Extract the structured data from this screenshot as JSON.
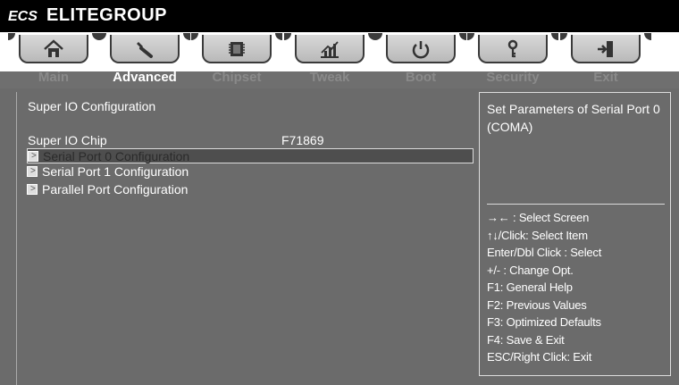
{
  "brand": {
    "name": "ELITEGROUP",
    "logo": "ECS"
  },
  "tabs": [
    {
      "label": "Main",
      "icon": "home-icon",
      "active": false
    },
    {
      "label": "Advanced",
      "icon": "wrench-icon",
      "active": true
    },
    {
      "label": "Chipset",
      "icon": "chip-icon",
      "active": false
    },
    {
      "label": "Tweak",
      "icon": "chart-icon",
      "active": false
    },
    {
      "label": "Boot",
      "icon": "power-icon",
      "active": false
    },
    {
      "label": "Security",
      "icon": "key-icon",
      "active": false
    },
    {
      "label": "Exit",
      "icon": "exit-icon",
      "active": false
    }
  ],
  "left": {
    "title": "Super IO Configuration",
    "chip_label": "Super IO Chip",
    "chip_value": "F71869",
    "menu": [
      {
        "label": "Serial Port 0 Configuration",
        "selected": true
      },
      {
        "label": "Serial Port 1 Configuration",
        "selected": false
      },
      {
        "label": "Parallel Port Configuration",
        "selected": false
      }
    ]
  },
  "help": {
    "description": "Set Parameters of Serial Port 0 (COMA)",
    "keys": [
      "→←  : Select Screen",
      "↑↓/Click: Select Item",
      "Enter/Dbl Click : Select",
      "+/- : Change Opt.",
      "F1: General Help",
      "F2: Previous Values",
      "F3: Optimized Defaults",
      "F4: Save & Exit",
      "ESC/Right Click: Exit"
    ]
  },
  "colors": {
    "background": "#6b6b6b",
    "brand_bar": "#000000",
    "text": "#ffffff",
    "inactive_tab_label": "#8a8a8a",
    "selected_row": "#4e4e4e"
  }
}
